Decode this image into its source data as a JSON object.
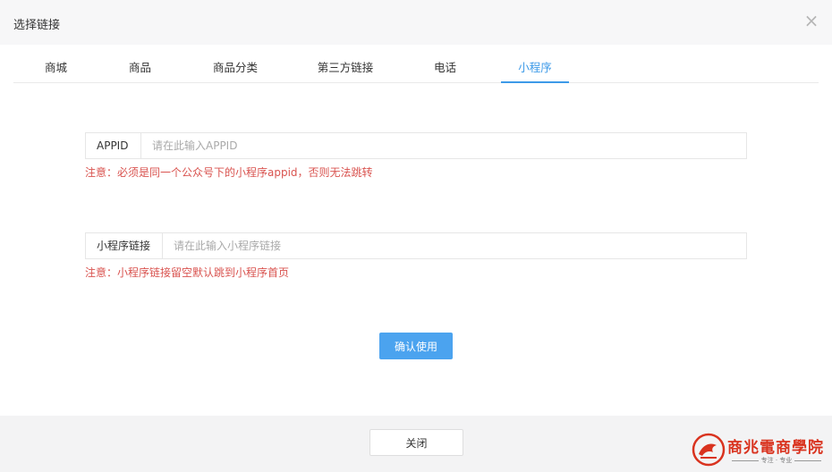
{
  "dialog": {
    "title": "选择链接",
    "close_symbol": "×"
  },
  "tabs": [
    {
      "label": "商城"
    },
    {
      "label": "商品"
    },
    {
      "label": "商品分类"
    },
    {
      "label": "第三方链接"
    },
    {
      "label": "电话"
    },
    {
      "label": "小程序"
    }
  ],
  "active_tab": "小程序",
  "appid": {
    "label": "APPID",
    "placeholder": "请在此输入APPID",
    "value": "",
    "note": "注意：必须是同一个公众号下的小程序appid，否则无法跳转"
  },
  "mini_link": {
    "label": "小程序链接",
    "placeholder": "请在此输入小程序链接",
    "value": "",
    "note": "注意：小程序链接留空默认跳到小程序首页"
  },
  "confirm_label": "确认使用",
  "footer": {
    "close_label": "关闭"
  },
  "watermark": {
    "brand": "商兆電商學院",
    "slogan": "专注 · 专业"
  },
  "colors": {
    "accent": "#3d9ae8",
    "primary_button": "#4ba3ef",
    "note": "#d9534f",
    "brand": "#d9331f"
  }
}
